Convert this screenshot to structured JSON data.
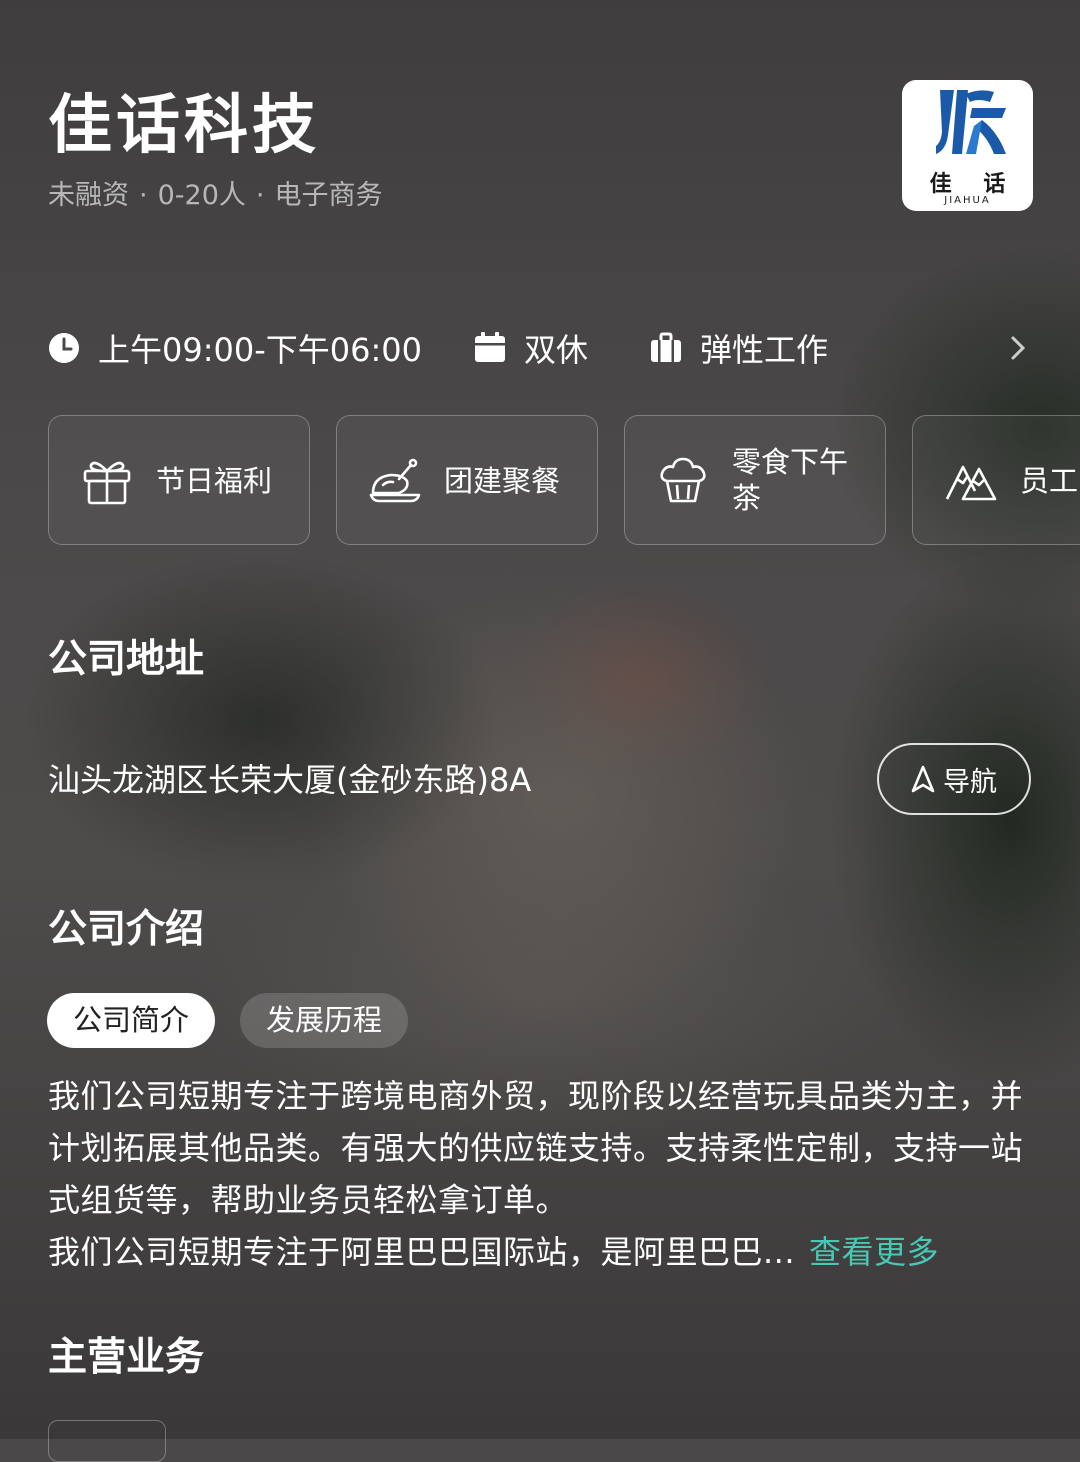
{
  "company": {
    "name": "佳话科技",
    "funding": "未融资",
    "size": "0-20人",
    "industry": "电子商务",
    "separator": "·",
    "logo": {
      "cn": "佳 话",
      "en": "JIAHUA",
      "color": "#1a5aa8"
    }
  },
  "work_info": {
    "hours": "上午09:00-下午06:00",
    "rest": "双休",
    "mode": "弹性工作",
    "icons": [
      "clock-icon",
      "calendar-icon",
      "briefcase-icon",
      "chevron-right-icon"
    ]
  },
  "benefits": [
    {
      "label": "节日福利",
      "icon": "gift-icon"
    },
    {
      "label": "团建聚餐",
      "icon": "roast-chicken-icon"
    },
    {
      "label": "零食下午茶",
      "icon": "cupcake-icon"
    },
    {
      "label": "员工",
      "icon": "mountain-icon"
    }
  ],
  "address_section": {
    "title": "公司地址",
    "address": "汕头龙湖区长荣大厦(金砂东路)8A",
    "nav_label": "导航"
  },
  "intro_section": {
    "title": "公司介绍",
    "tabs": [
      {
        "label": "公司简介",
        "active": true
      },
      {
        "label": "发展历程",
        "active": false
      }
    ],
    "paragraph1": "我们公司短期专注于跨境电商外贸，现阶段以经营玩具品类为主，并计划拓展其他品类。有强大的供应链支持。支持柔性定制，支持一站式组货等，帮助业务员轻松拿订单。",
    "paragraph2": "我们公司短期专注于阿里巴巴国际站，是阿里巴巴...",
    "more_label": "查看更多",
    "more_color": "#47c8b5"
  },
  "business_section": {
    "title": "主营业务"
  }
}
